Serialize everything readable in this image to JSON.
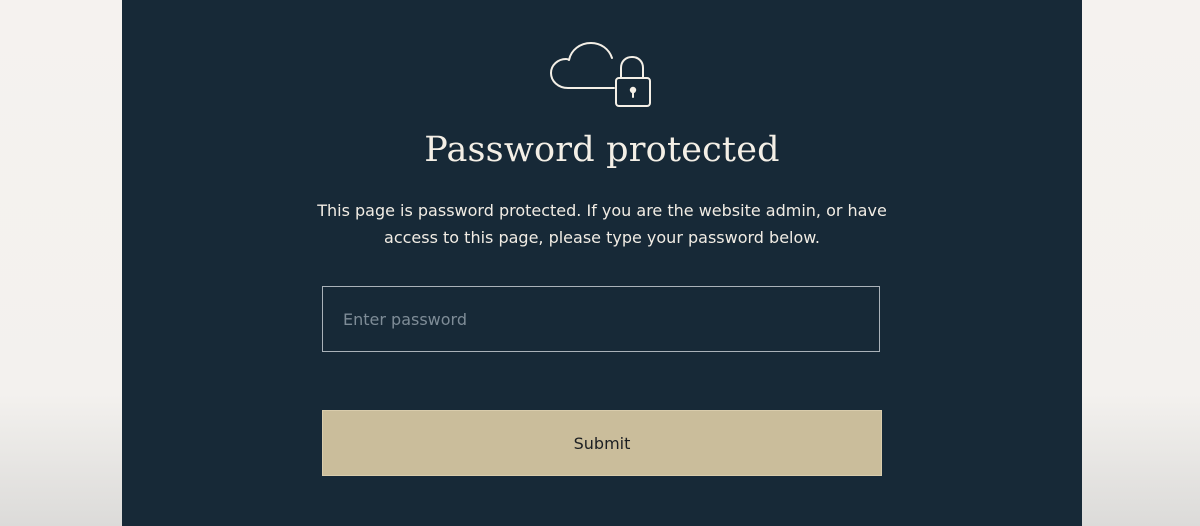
{
  "page": {
    "title": "Password protected",
    "description": "This page is password protected. If you are  the website admin, or have access to this page, please type your password below."
  },
  "form": {
    "password_placeholder": "Enter password",
    "password_value": "",
    "submit_label": "Submit"
  },
  "icon": {
    "name": "cloud-lock-icon"
  },
  "colors": {
    "panel_bg": "#172937",
    "outer_bg": "#f4f1ee",
    "text": "#f4efe6",
    "button_bg": "#cabd9b",
    "button_text": "#1c1f22",
    "input_border": "#aab2b9",
    "placeholder": "#7e8c97"
  }
}
